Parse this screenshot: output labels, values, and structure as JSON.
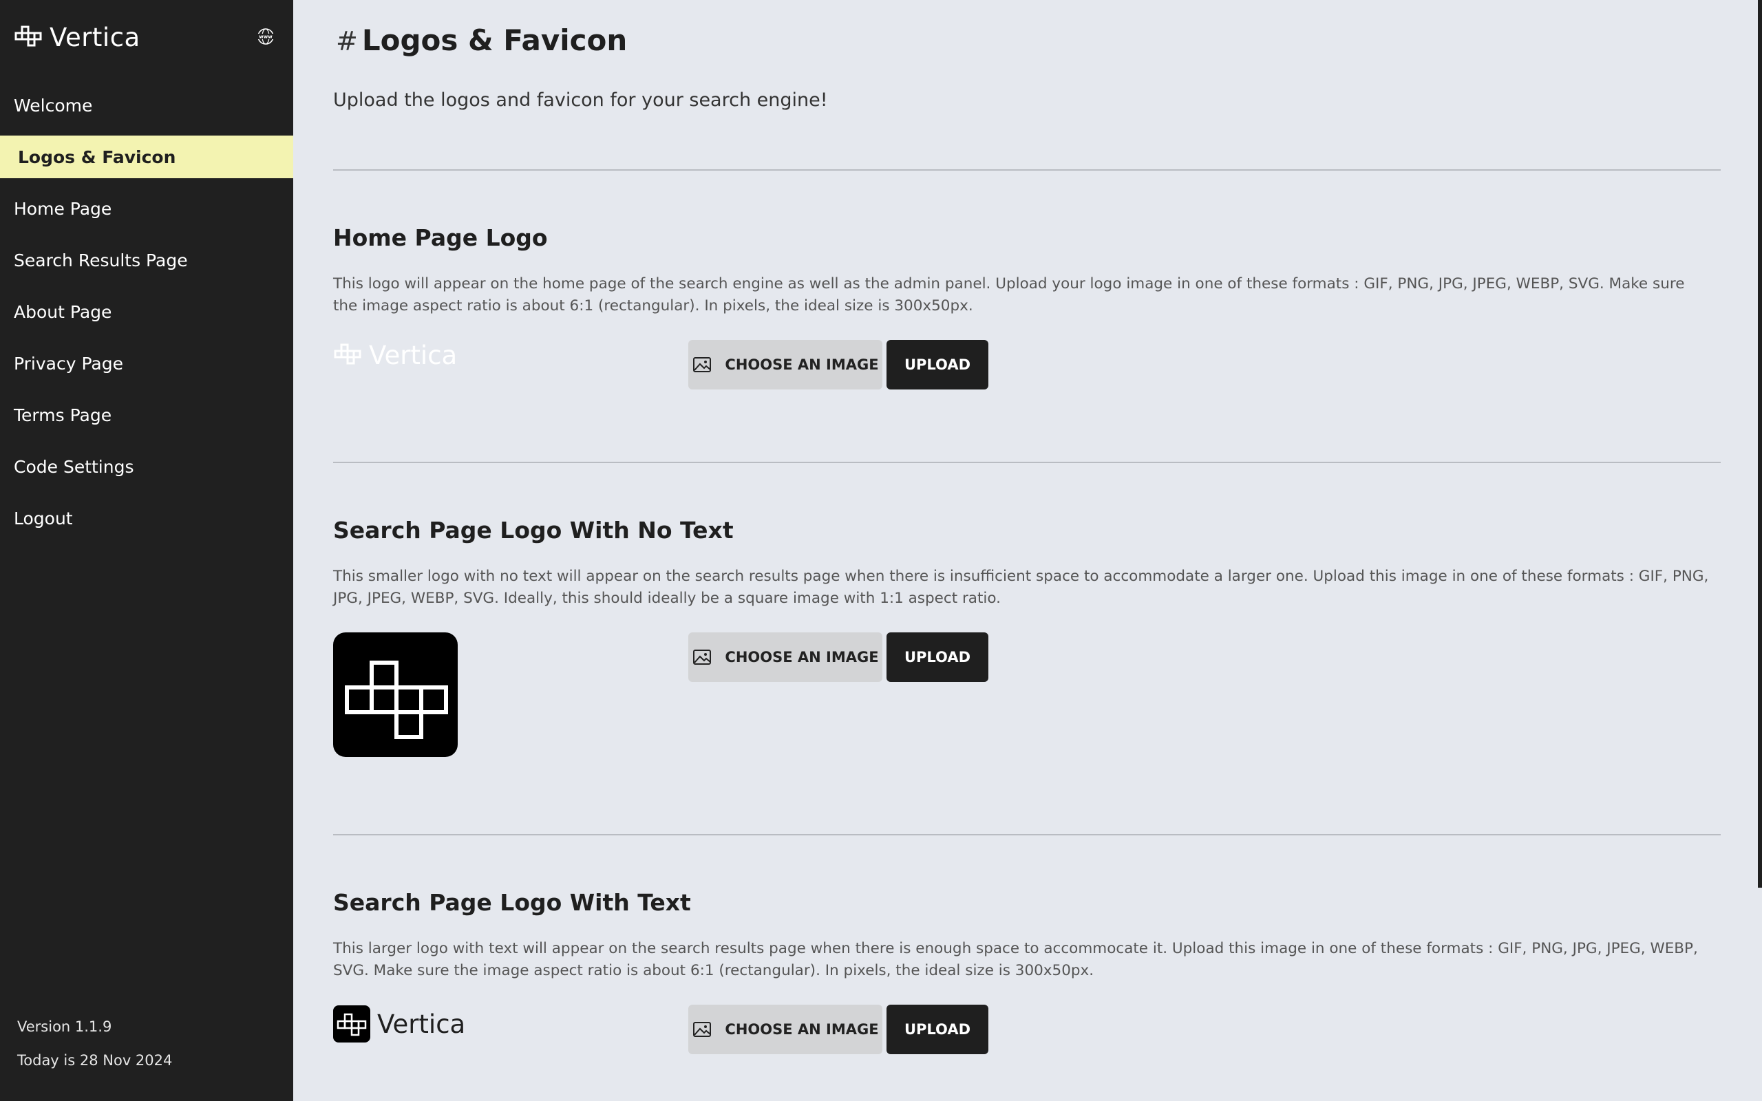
{
  "sidebar": {
    "brand": "Vertica",
    "items": [
      {
        "label": "Welcome"
      },
      {
        "label": "Logos & Favicon",
        "active": true
      },
      {
        "label": "Home Page"
      },
      {
        "label": "Search Results Page"
      },
      {
        "label": "About Page"
      },
      {
        "label": "Privacy Page"
      },
      {
        "label": "Terms Page"
      },
      {
        "label": "Code Settings"
      },
      {
        "label": "Logout"
      }
    ],
    "version": "Version 1.1.9",
    "today": "Today is 28 Nov 2024"
  },
  "page": {
    "hash": "#",
    "title": "Logos & Favicon",
    "subtitle": "Upload the logos and favicon for your search engine!"
  },
  "sections": [
    {
      "title": "Home Page Logo",
      "description": "This logo will appear on the home page of the search engine as well as the admin panel. Upload your logo image in one of these formats : GIF, PNG, JPG, JPEG, WEBP, SVG. Make sure the image aspect ratio is about 6:1 (rectangular). In pixels, the ideal size is 300x50px.",
      "preview_text": "Vertica",
      "choose_label": "CHOOSE AN IMAGE",
      "upload_label": "UPLOAD"
    },
    {
      "title": "Search Page Logo With No Text",
      "description": "This smaller logo with no text will appear on the search results page when there is insufficient space to accommodate a larger one. Upload this image in one of these formats : GIF, PNG, JPG, JPEG, WEBP, SVG. Ideally, this should ideally be a square image with 1:1 aspect ratio.",
      "choose_label": "CHOOSE AN IMAGE",
      "upload_label": "UPLOAD"
    },
    {
      "title": "Search Page Logo With Text",
      "description": "This larger logo with text will appear on the search results page when there is enough space to accommocate it. Upload this image in one of these formats : GIF, PNG, JPG, JPEG, WEBP, SVG. Make sure the image aspect ratio is about 6:1 (rectangular). In pixels, the ideal size is 300x50px.",
      "preview_text": "Vertica",
      "choose_label": "CHOOSE AN IMAGE",
      "upload_label": "UPLOAD"
    }
  ],
  "icons": {
    "brand": "vertica-cross-icon",
    "language": "www-globe-icon",
    "image": "image-icon"
  },
  "colors": {
    "sidebar_bg": "#202020",
    "active_bg": "#f3f3b1",
    "main_bg": "#e5e8ee",
    "upload_bg": "#1f1f1f",
    "choose_bg": "#d3d4d6"
  }
}
